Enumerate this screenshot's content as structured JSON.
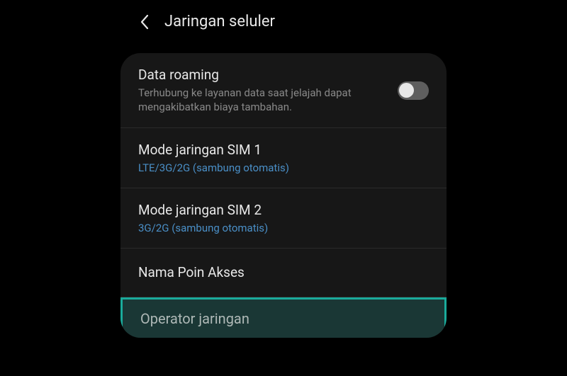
{
  "header": {
    "title": "Jaringan seluler"
  },
  "settings": {
    "dataRoaming": {
      "title": "Data roaming",
      "subtitle": "Terhubung ke layanan data saat jelajah dapat mengakibatkan biaya tambahan.",
      "enabled": false
    },
    "sim1Mode": {
      "title": "Mode jaringan SIM 1",
      "value": "LTE/3G/2G (sambung otomatis)"
    },
    "sim2Mode": {
      "title": "Mode jaringan SIM 2",
      "value": "3G/2G (sambung otomatis)"
    },
    "apn": {
      "title": "Nama Poin Akses"
    },
    "operator": {
      "title": "Operator jaringan"
    }
  }
}
